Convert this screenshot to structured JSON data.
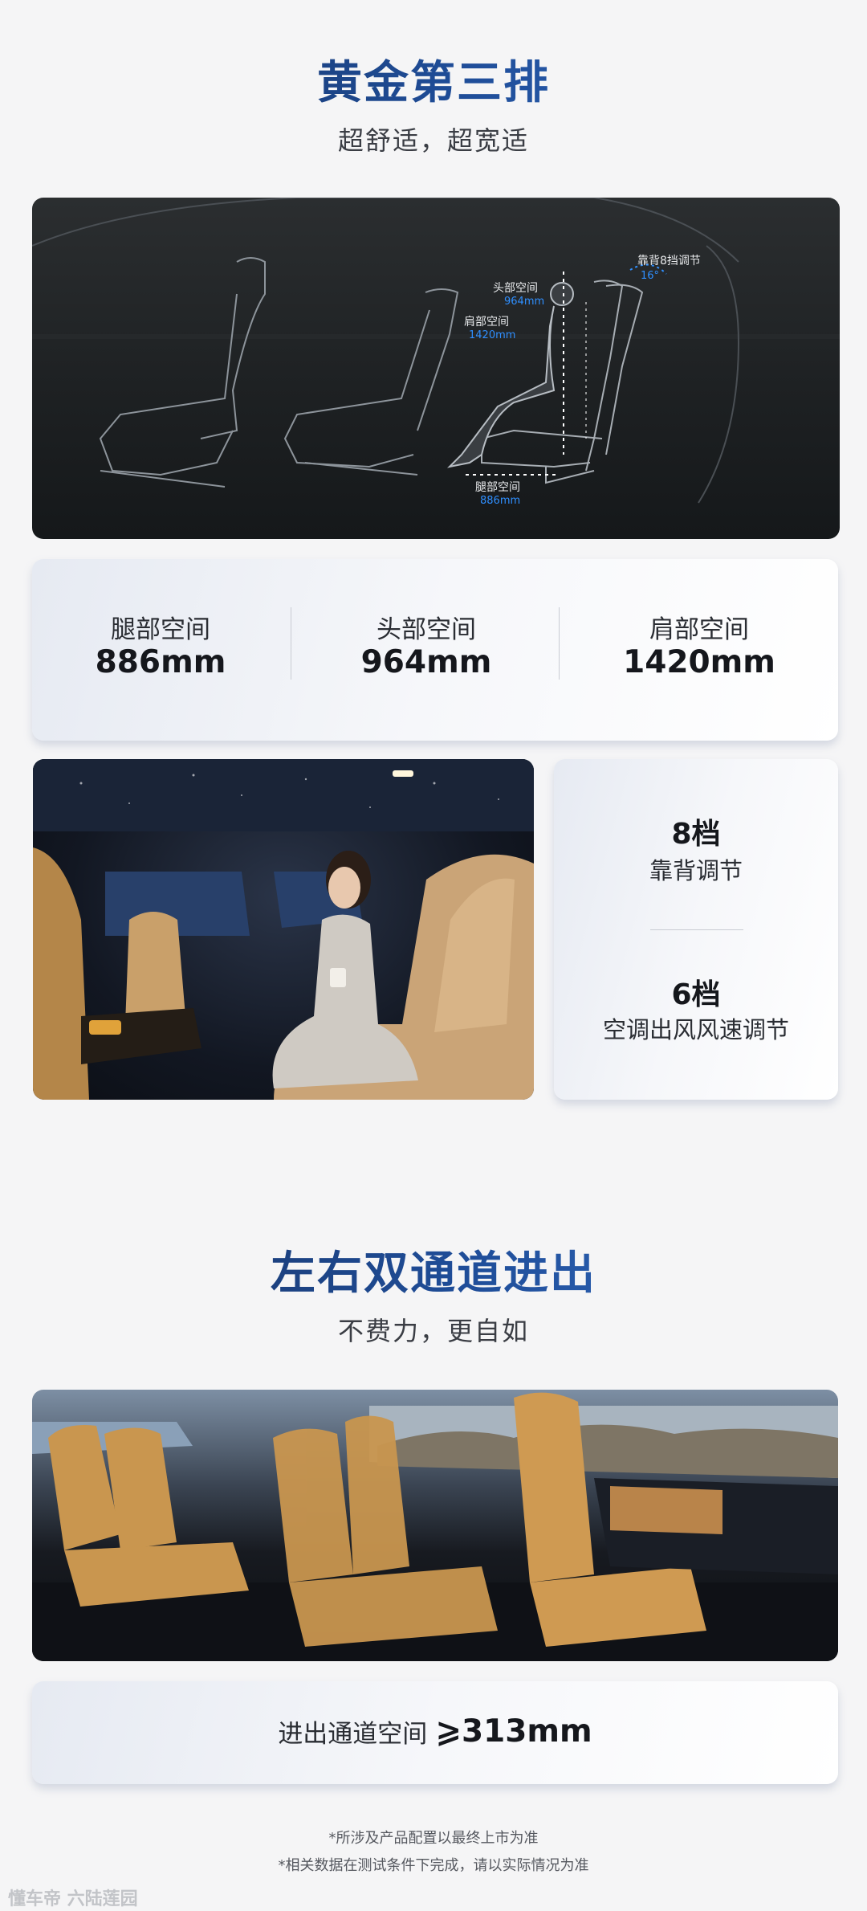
{
  "section1": {
    "title": "黄金第三排",
    "subtitle": "超舒适，超宽适"
  },
  "diagram": {
    "backrest_label": "靠背8挡调节",
    "backrest_angle": "16°",
    "head_label": "头部空间",
    "head_value": "964mm",
    "shoulder_label": "肩部空间",
    "shoulder_value": "1420mm",
    "leg_label": "腿部空间",
    "leg_value": "886mm"
  },
  "dimensions": [
    {
      "label": "腿部空间",
      "value": "886mm"
    },
    {
      "label": "头部空间",
      "value": "964mm"
    },
    {
      "label": "肩部空间",
      "value": "1420mm"
    }
  ],
  "features": [
    {
      "big": "8档",
      "small": "靠背调节"
    },
    {
      "big": "6档",
      "small": "空调出风风速调节"
    }
  ],
  "section2": {
    "title": "左右双通道进出",
    "subtitle": "不费力，更自如"
  },
  "aisle": {
    "label": "进出通道空间",
    "value": "⩾313mm"
  },
  "notes": [
    "*所涉及产品配置以最终上市为准",
    "*相关数据在测试条件下完成，请以实际情况为准"
  ],
  "watermark": "懂车帝 六陆莲园",
  "colors": {
    "accent_blue": "#1f4e9a",
    "diagram_value_blue": "#2f8fff",
    "seat_tan": "#c9964f"
  }
}
